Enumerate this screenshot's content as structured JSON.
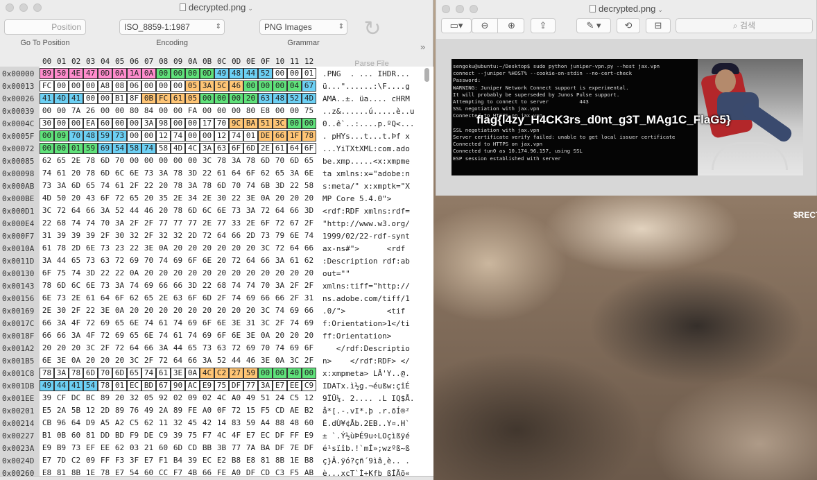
{
  "hex_window": {
    "title": "decrypted.png",
    "toolbar": {
      "position_placeholder": "Position",
      "go_to_position": "Go To Position",
      "encoding_value": "ISO_8859-1:1987",
      "encoding_label": "Encoding",
      "grammar_value": "PNG Images",
      "grammar_label": "Grammar",
      "parse_file_label": "Parse File",
      "more": "»"
    },
    "column_header": [
      "00",
      "01",
      "02",
      "03",
      "04",
      "05",
      "06",
      "07",
      "08",
      "09",
      "0A",
      "0B",
      "0C",
      "0D",
      "0E",
      "0F",
      "10",
      "11",
      "12"
    ],
    "rows": [
      {
        "offset": "0x00000",
        "bytes": [
          "89",
          "50",
          "4E",
          "47",
          "0D",
          "0A",
          "1A",
          "0A",
          "00",
          "00",
          "00",
          "0D",
          "49",
          "48",
          "44",
          "52",
          "00",
          "00",
          "01"
        ],
        "colors": [
          "pink",
          "pink",
          "pink",
          "pink",
          "pink",
          "pink",
          "pink",
          "pink",
          "green",
          "green",
          "green",
          "green",
          "blue",
          "blue",
          "blue",
          "blue",
          "white",
          "white",
          "white"
        ],
        "ascii": ".PNG  . ... IHDR..."
      },
      {
        "offset": "0x00013",
        "bytes": [
          "FC",
          "00",
          "00",
          "00",
          "A8",
          "08",
          "06",
          "00",
          "00",
          "00",
          "05",
          "3A",
          "5C",
          "46",
          "00",
          "00",
          "00",
          "04",
          "67"
        ],
        "colors": [
          "white",
          "white",
          "white",
          "white",
          "white",
          "white",
          "white",
          "white",
          "white",
          "white",
          "orange",
          "orange",
          "orange",
          "orange",
          "green",
          "green",
          "green",
          "green",
          "blue"
        ],
        "ascii": "ü...\"......:\\F....g"
      },
      {
        "offset": "0x00026",
        "bytes": [
          "41",
          "4D",
          "41",
          "00",
          "00",
          "B1",
          "8F",
          "0B",
          "FC",
          "61",
          "05",
          "00",
          "00",
          "00",
          "20",
          "63",
          "48",
          "52",
          "4D"
        ],
        "colors": [
          "blue",
          "blue",
          "blue",
          "white",
          "white",
          "white",
          "white",
          "orange",
          "orange",
          "orange",
          "orange",
          "green",
          "green",
          "green",
          "green",
          "blue",
          "blue",
          "blue",
          "blue"
        ],
        "ascii": "AMA..±. üa.... cHRM"
      },
      {
        "offset": "0x00039",
        "bytes": [
          "00",
          "00",
          "7A",
          "26",
          "00",
          "00",
          "80",
          "84",
          "00",
          "00",
          "FA",
          "00",
          "00",
          "00",
          "80",
          "E8",
          "00",
          "00",
          "75"
        ],
        "colors": [],
        "ascii": "..z&......ú.....è..u"
      },
      {
        "offset": "0x0004C",
        "bytes": [
          "30",
          "00",
          "00",
          "EA",
          "60",
          "00",
          "00",
          "3A",
          "98",
          "00",
          "00",
          "17",
          "70",
          "9C",
          "BA",
          "51",
          "3C",
          "00",
          "00"
        ],
        "colors": [
          "white",
          "white",
          "white",
          "white",
          "white",
          "white",
          "white",
          "white",
          "white",
          "white",
          "white",
          "white",
          "white",
          "orange",
          "orange",
          "orange",
          "orange",
          "green",
          "green"
        ],
        "ascii": "0..ê`..:....p.ºQ<..."
      },
      {
        "offset": "0x0005F",
        "bytes": [
          "00",
          "09",
          "70",
          "48",
          "59",
          "73",
          "00",
          "00",
          "12",
          "74",
          "00",
          "00",
          "12",
          "74",
          "01",
          "DE",
          "66",
          "1F",
          "78"
        ],
        "colors": [
          "green",
          "green",
          "blue",
          "blue",
          "blue",
          "blue",
          "white",
          "white",
          "white",
          "white",
          "white",
          "white",
          "white",
          "white",
          "white",
          "orange",
          "orange",
          "orange",
          "orange"
        ],
        "ascii": ". pHYs...t...t.Þf x"
      },
      {
        "offset": "0x00072",
        "bytes": [
          "00",
          "00",
          "01",
          "59",
          "69",
          "54",
          "58",
          "74",
          "58",
          "4D",
          "4C",
          "3A",
          "63",
          "6F",
          "6D",
          "2E",
          "61",
          "64",
          "6F"
        ],
        "colors": [
          "green",
          "green",
          "green",
          "green",
          "blue",
          "blue",
          "blue",
          "blue"
        ],
        "ascii": "...YiTXtXML:com.ado"
      },
      {
        "offset": "0x00085",
        "bytes": [
          "62",
          "65",
          "2E",
          "78",
          "6D",
          "70",
          "00",
          "00",
          "00",
          "00",
          "00",
          "3C",
          "78",
          "3A",
          "78",
          "6D",
          "70",
          "6D",
          "65"
        ],
        "colors": [],
        "ascii": "be.xmp.....<x:xmpme"
      },
      {
        "offset": "0x00098",
        "bytes": [
          "74",
          "61",
          "20",
          "78",
          "6D",
          "6C",
          "6E",
          "73",
          "3A",
          "78",
          "3D",
          "22",
          "61",
          "64",
          "6F",
          "62",
          "65",
          "3A",
          "6E"
        ],
        "colors": [],
        "ascii": "ta xmlns:x=\"adobe:n"
      },
      {
        "offset": "0x000AB",
        "bytes": [
          "73",
          "3A",
          "6D",
          "65",
          "74",
          "61",
          "2F",
          "22",
          "20",
          "78",
          "3A",
          "78",
          "6D",
          "70",
          "74",
          "6B",
          "3D",
          "22",
          "58"
        ],
        "colors": [],
        "ascii": "s:meta/\" x:xmptk=\"X"
      },
      {
        "offset": "0x000BE",
        "bytes": [
          "4D",
          "50",
          "20",
          "43",
          "6F",
          "72",
          "65",
          "20",
          "35",
          "2E",
          "34",
          "2E",
          "30",
          "22",
          "3E",
          "0A",
          "20",
          "20",
          "20"
        ],
        "colors": [],
        "ascii": "MP Core 5.4.0\">"
      },
      {
        "offset": "0x000D1",
        "bytes": [
          "3C",
          "72",
          "64",
          "66",
          "3A",
          "52",
          "44",
          "46",
          "20",
          "78",
          "6D",
          "6C",
          "6E",
          "73",
          "3A",
          "72",
          "64",
          "66",
          "3D"
        ],
        "colors": [],
        "ascii": "<rdf:RDF xmlns:rdf="
      },
      {
        "offset": "0x000E4",
        "bytes": [
          "22",
          "68",
          "74",
          "74",
          "70",
          "3A",
          "2F",
          "2F",
          "77",
          "77",
          "77",
          "2E",
          "77",
          "33",
          "2E",
          "6F",
          "72",
          "67",
          "2F"
        ],
        "colors": [],
        "ascii": "\"http://www.w3.org/"
      },
      {
        "offset": "0x000F7",
        "bytes": [
          "31",
          "39",
          "39",
          "39",
          "2F",
          "30",
          "32",
          "2F",
          "32",
          "32",
          "2D",
          "72",
          "64",
          "66",
          "2D",
          "73",
          "79",
          "6E",
          "74"
        ],
        "colors": [],
        "ascii": "1999/02/22-rdf-synt"
      },
      {
        "offset": "0x0010A",
        "bytes": [
          "61",
          "78",
          "2D",
          "6E",
          "73",
          "23",
          "22",
          "3E",
          "0A",
          "20",
          "20",
          "20",
          "20",
          "20",
          "20",
          "3C",
          "72",
          "64",
          "66"
        ],
        "colors": [],
        "ascii": "ax-ns#\">      <rdf"
      },
      {
        "offset": "0x0011D",
        "bytes": [
          "3A",
          "44",
          "65",
          "73",
          "63",
          "72",
          "69",
          "70",
          "74",
          "69",
          "6F",
          "6E",
          "20",
          "72",
          "64",
          "66",
          "3A",
          "61",
          "62"
        ],
        "colors": [],
        "ascii": ":Description rdf:ab"
      },
      {
        "offset": "0x00130",
        "bytes": [
          "6F",
          "75",
          "74",
          "3D",
          "22",
          "22",
          "0A",
          "20",
          "20",
          "20",
          "20",
          "20",
          "20",
          "20",
          "20",
          "20",
          "20",
          "20",
          "20"
        ],
        "colors": [],
        "ascii": "out=\"\""
      },
      {
        "offset": "0x00143",
        "bytes": [
          "78",
          "6D",
          "6C",
          "6E",
          "73",
          "3A",
          "74",
          "69",
          "66",
          "66",
          "3D",
          "22",
          "68",
          "74",
          "74",
          "70",
          "3A",
          "2F",
          "2F"
        ],
        "colors": [],
        "ascii": "xmlns:tiff=\"http://"
      },
      {
        "offset": "0x00156",
        "bytes": [
          "6E",
          "73",
          "2E",
          "61",
          "64",
          "6F",
          "62",
          "65",
          "2E",
          "63",
          "6F",
          "6D",
          "2F",
          "74",
          "69",
          "66",
          "66",
          "2F",
          "31"
        ],
        "colors": [],
        "ascii": "ns.adobe.com/tiff/1"
      },
      {
        "offset": "0x00169",
        "bytes": [
          "2E",
          "30",
          "2F",
          "22",
          "3E",
          "0A",
          "20",
          "20",
          "20",
          "20",
          "20",
          "20",
          "20",
          "20",
          "20",
          "3C",
          "74",
          "69",
          "66"
        ],
        "colors": [],
        "ascii": ".0/\">         <tif"
      },
      {
        "offset": "0x0017C",
        "bytes": [
          "66",
          "3A",
          "4F",
          "72",
          "69",
          "65",
          "6E",
          "74",
          "61",
          "74",
          "69",
          "6F",
          "6E",
          "3E",
          "31",
          "3C",
          "2F",
          "74",
          "69"
        ],
        "colors": [],
        "ascii": "f:Orientation>1</ti"
      },
      {
        "offset": "0x0018F",
        "bytes": [
          "66",
          "66",
          "3A",
          "4F",
          "72",
          "69",
          "65",
          "6E",
          "74",
          "61",
          "74",
          "69",
          "6F",
          "6E",
          "3E",
          "0A",
          "20",
          "20",
          "20"
        ],
        "colors": [],
        "ascii": "ff:Orientation>"
      },
      {
        "offset": "0x001A2",
        "bytes": [
          "20",
          "20",
          "20",
          "3C",
          "2F",
          "72",
          "64",
          "66",
          "3A",
          "44",
          "65",
          "73",
          "63",
          "72",
          "69",
          "70",
          "74",
          "69",
          "6F"
        ],
        "colors": [],
        "ascii": "   </rdf:Descriptio"
      },
      {
        "offset": "0x001B5",
        "bytes": [
          "6E",
          "3E",
          "0A",
          "20",
          "20",
          "20",
          "3C",
          "2F",
          "72",
          "64",
          "66",
          "3A",
          "52",
          "44",
          "46",
          "3E",
          "0A",
          "3C",
          "2F"
        ],
        "colors": [],
        "ascii": "n>    </rdf:RDF> </"
      },
      {
        "offset": "0x001C8",
        "bytes": [
          "78",
          "3A",
          "78",
          "6D",
          "70",
          "6D",
          "65",
          "74",
          "61",
          "3E",
          "0A",
          "4C",
          "C2",
          "27",
          "59",
          "00",
          "00",
          "40",
          "00"
        ],
        "colors": [
          "white",
          "white",
          "white",
          "white",
          "white",
          "white",
          "white",
          "white",
          "white",
          "white",
          "white",
          "orange",
          "orange",
          "orange",
          "orange",
          "green",
          "green",
          "green",
          "green"
        ],
        "ascii": "x:xmpmeta> LÂ'Y..@."
      },
      {
        "offset": "0x001DB",
        "bytes": [
          "49",
          "44",
          "41",
          "54",
          "78",
          "01",
          "EC",
          "BD",
          "67",
          "90",
          "AC",
          "E9",
          "75",
          "DF",
          "77",
          "3A",
          "E7",
          "EE",
          "C9"
        ],
        "colors": [
          "blue",
          "blue",
          "blue",
          "blue"
        ],
        "ascii": "IDATx.ì½g.¬éußw:çîÉ"
      },
      {
        "offset": "0x001EE",
        "bytes": [
          "39",
          "CF",
          "DC",
          "BC",
          "89",
          "20",
          "32",
          "05",
          "92",
          "02",
          "09",
          "02",
          "4C",
          "A0",
          "49",
          "51",
          "24",
          "C5",
          "12"
        ],
        "colors": [],
        "ascii": "9ÏÜ¼. 2.... .L IQ$Å."
      },
      {
        "offset": "0x00201",
        "bytes": [
          "E5",
          "2A",
          "5B",
          "12",
          "2D",
          "89",
          "76",
          "49",
          "2A",
          "89",
          "FE",
          "A0",
          "0F",
          "72",
          "15",
          "F5",
          "CD",
          "AE",
          "B2"
        ],
        "colors": [],
        "ascii": "å*[.-.vI*.þ .r.õÍ®²"
      },
      {
        "offset": "0x00214",
        "bytes": [
          "CB",
          "96",
          "64",
          "D9",
          "A5",
          "A2",
          "C5",
          "62",
          "11",
          "32",
          "45",
          "42",
          "14",
          "83",
          "59",
          "A4",
          "88",
          "48",
          "60"
        ],
        "colors": [],
        "ascii": "Ë.dÙ¥¢Åb.2EB..Y¤.H`"
      },
      {
        "offset": "0x00227",
        "bytes": [
          "B1",
          "0B",
          "60",
          "81",
          "DD",
          "BD",
          "F9",
          "DE",
          "C9",
          "39",
          "75",
          "F7",
          "4C",
          "4F",
          "E7",
          "EC",
          "DF",
          "FF",
          "E9"
        ],
        "colors": [],
        "ascii": "± `.Ý½ùÞÉ9u÷LOçìßÿé"
      },
      {
        "offset": "0x0023A",
        "bytes": [
          "E9",
          "B9",
          "73",
          "EF",
          "EE",
          "62",
          "03",
          "21",
          "60",
          "6D",
          "CD",
          "BB",
          "3B",
          "77",
          "7A",
          "BA",
          "DF",
          "7E",
          "DF"
        ],
        "colors": [],
        "ascii": "é¹sïîb.!`mÍ»;wzºß~ß"
      },
      {
        "offset": "0x0024D",
        "bytes": [
          "E7",
          "7D",
          "C2",
          "09",
          "FF",
          "F3",
          "3F",
          "E7",
          "F1",
          "B4",
          "39",
          "EC",
          "E2",
          "B8",
          "E8",
          "81",
          "8B",
          "1E",
          "B8"
        ],
        "colors": [],
        "ascii": "ç}Â.ÿó?çñ´9ìâ¸è.. ."
      },
      {
        "offset": "0x00260",
        "bytes": [
          "E8",
          "81",
          "8B",
          "1E",
          "78",
          "E7",
          "54",
          "60",
          "CC",
          "F7",
          "4B",
          "66",
          "FE",
          "A0",
          "DF",
          "CD",
          "C3",
          "F5",
          "AB"
        ],
        "colors": [],
        "ascii": "è...xçT`Ì÷Kfþ ßÍÃõ«"
      }
    ]
  },
  "preview_window": {
    "title": "decrypted.png",
    "search_placeholder": "검색",
    "flag_text": "flag{l4zy_H4CK3rs_d0nt_g3T_MAg1C_FlaG5}",
    "terminal_lines": [
      "sengoku@ubuntu:~/Desktop$ sudo python juniper-vpn.py --host jax.vpn",
      "connect --juniper %HOST% --cookie-on-stdin --no-cert-check",
      "Password:",
      "WARNING: Juniper Network Connect support is experimental.",
      "It will probably be superseded by Junos Pulse support.",
      "Attempting to connect to server          443",
      "SSL negotiation with jax.vpn",
      "Connected to HTTPS on jax.vpn",
      "",
      "SSL negotiation with jax.vpn",
      "Server certificate verify failed: unable to get local issuer certificate",
      "Connected to HTTPS on jax.vpn",
      "Connected tun0 as 10.174.96.157, using SSL",
      "ESP session established with server"
    ]
  },
  "desktop": {
    "corner_label": "$RECT"
  }
}
